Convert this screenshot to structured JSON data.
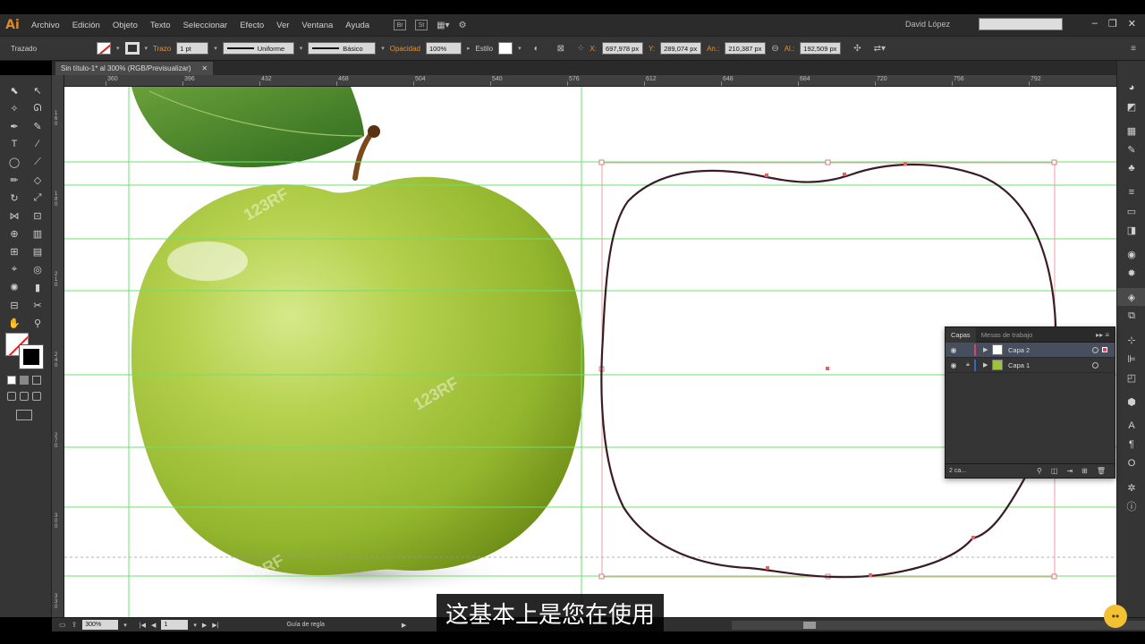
{
  "app": {
    "logo": "Ai",
    "user": "David López"
  },
  "menu": [
    "Archivo",
    "Edición",
    "Objeto",
    "Texto",
    "Seleccionar",
    "Efecto",
    "Ver",
    "Ventana",
    "Ayuda"
  ],
  "menu_icons": {
    "br": "Br",
    "st": "St"
  },
  "window_buttons": {
    "min": "–",
    "max": "❐",
    "close": "✕"
  },
  "control": {
    "object_type": "Trazado",
    "stroke_label": "Trazo",
    "stroke_weight": "1 pt",
    "profile": "Uniforme",
    "brush": "Básico",
    "opacity_label": "Opacidad",
    "opacity": "100%",
    "style_label": "Estilo",
    "x_label": "X:",
    "x": "697,978 px",
    "y_label": "Y:",
    "y": "289,074 px",
    "w_label": "An.:",
    "w": "210,387 px",
    "h_label": "Al.:",
    "h": "192,509 px"
  },
  "document": {
    "tab": "Sin título-1* al 300% (RGB/Previsualizar)",
    "close": "✕"
  },
  "ruler_top": [
    "360",
    "396",
    "432",
    "468",
    "504",
    "540",
    "576",
    "612",
    "648",
    "684",
    "720",
    "756",
    "792"
  ],
  "ruler_left": [
    "1 6 0",
    "1 8 0",
    "2 1 0",
    "2 4 0",
    "2 7 0",
    "3 0 0",
    "3 3 0"
  ],
  "layers_panel": {
    "tabs": [
      "Capas",
      "Mesas de trabajo"
    ],
    "menu_glyph": "▸▸ ≡",
    "layers": [
      {
        "name": "Capa 2",
        "color": "#e04060",
        "selected": true
      },
      {
        "name": "Capa 1",
        "color": "#3c64c8",
        "selected": false
      }
    ],
    "footer": "2 ca..."
  },
  "status": {
    "zoom": "300%",
    "page": "1",
    "tool": "Guía de regla"
  },
  "subtitle": "这基本上是您在使用",
  "watermark": "123RF"
}
